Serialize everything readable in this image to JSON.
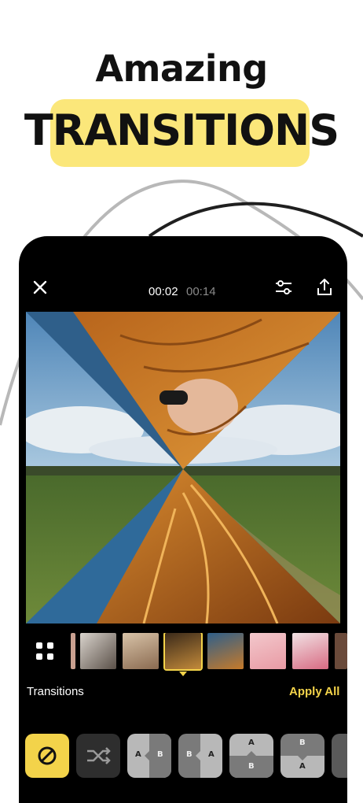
{
  "promo": {
    "headline_line1": "Amazing",
    "headline_line2": "TRANSITIONS"
  },
  "editor": {
    "time_current": "00:02",
    "time_total": "00:14",
    "icons": {
      "close": "close-icon",
      "settings": "sliders-icon",
      "export": "export-icon",
      "grid": "grid-icon"
    }
  },
  "transitions_panel": {
    "title": "Transitions",
    "apply_all": "Apply All",
    "options": [
      {
        "name": "none",
        "icon": "no-transition-icon",
        "selected": true
      },
      {
        "name": "shuffle",
        "icon": "shuffle-icon"
      },
      {
        "name": "slide-left",
        "label_a": "A",
        "label_b": "B"
      },
      {
        "name": "slide-right",
        "label_a": "B",
        "label_b": "A"
      },
      {
        "name": "slide-down",
        "label_a": "A",
        "label_b": "B"
      },
      {
        "name": "slide-up",
        "label_a": "B",
        "label_b": "A"
      }
    ]
  },
  "colors": {
    "accent_yellow": "#f3d34a",
    "highlight_yellow": "#fbe77a",
    "dark_background": "#000000",
    "button_gray": "#2e2e2e"
  }
}
